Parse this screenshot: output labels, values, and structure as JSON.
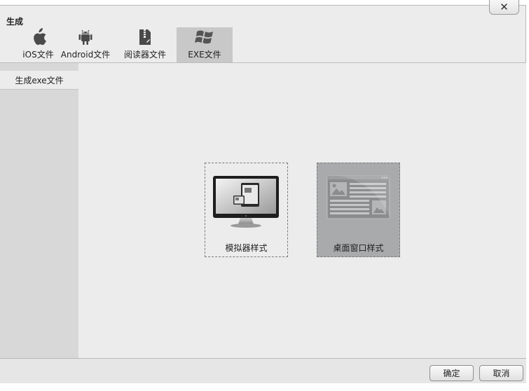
{
  "window": {
    "title": "生成",
    "close_symbol": "✕"
  },
  "tabs": [
    {
      "label": "iOS文件",
      "icon": "apple-icon"
    },
    {
      "label": "Android文件",
      "icon": "android-icon"
    },
    {
      "label": "阅读器文件",
      "icon": "reader-file-icon"
    },
    {
      "label": "EXE文件",
      "icon": "windows-icon",
      "selected": true
    }
  ],
  "sidebar": {
    "items": [
      {
        "label": "生成exe文件",
        "selected": true
      }
    ]
  },
  "options": [
    {
      "label": "模拟器样式",
      "icon": "monitor-icon"
    },
    {
      "label": "桌面窗口样式",
      "icon": "desktop-window-icon",
      "selected": true
    }
  ],
  "footer": {
    "ok_label": "确定",
    "cancel_label": "取消"
  },
  "colors": {
    "selected_tab_bg": "#c8c8c8",
    "selected_option_bg": "#a8aaac",
    "sidebar_bg": "#d8d8d8"
  }
}
